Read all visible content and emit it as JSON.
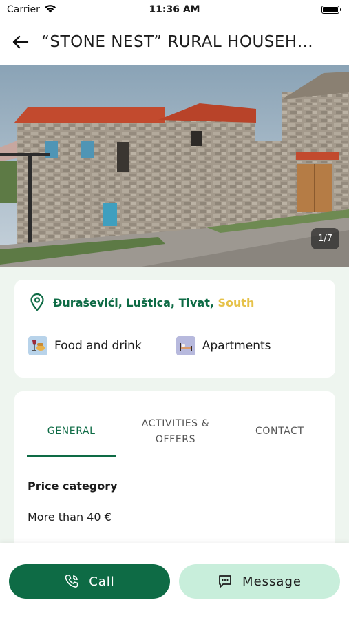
{
  "status": {
    "carrier": "Carrier",
    "time": "11:36 AM",
    "battery_level": 1.0
  },
  "nav": {
    "title": "“STONE NEST” RURAL HOUSEH…",
    "back_icon": "arrow-left-icon"
  },
  "gallery": {
    "counter": "1/7"
  },
  "location": {
    "place": "Đuraševići, Luštica, Tivat,",
    "region": "South",
    "icon": "map-pin-icon"
  },
  "tags": [
    {
      "label": "Food and drink",
      "icon": "food-drink-icon"
    },
    {
      "label": "Apartments",
      "icon": "bed-icon"
    }
  ],
  "tabs": {
    "general": "GENERAL",
    "activities": "ACTIVITIES & OFFERS",
    "contact": "CONTACT"
  },
  "general": {
    "price_label": "Price category",
    "price_value": "More than 40 €"
  },
  "actions": {
    "call_label": "Call",
    "message_label": "Message"
  },
  "colors": {
    "primary": "#0e6b45",
    "secondary": "#c8eedb",
    "region": "#e6c24a",
    "background": "#eef5ef"
  }
}
